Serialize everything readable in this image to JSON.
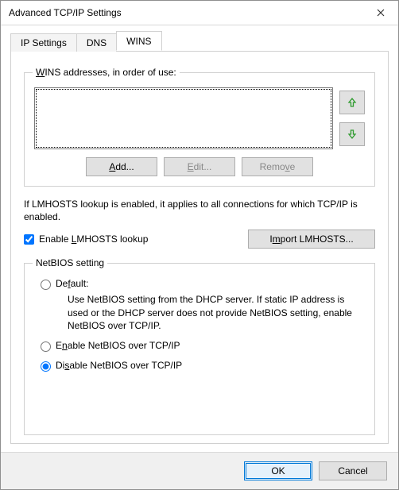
{
  "window": {
    "title": "Advanced TCP/IP Settings"
  },
  "tabs": {
    "ip_settings": "IP Settings",
    "dns": "DNS",
    "wins": "WINS",
    "active": "wins"
  },
  "wins": {
    "group_label": "WINS addresses, in order of use:",
    "group_label_html": "<span class='u'>W</span>INS addresses, in order of use:",
    "add": "Add...",
    "add_html": "<span class='u'>A</span>dd...",
    "edit": "Edit...",
    "edit_html": "<span class='u'>E</span>dit...",
    "remove": "Remove",
    "remove_html": "Remo<span class='u'>v</span>e"
  },
  "lmhosts": {
    "info": "If LMHOSTS lookup is enabled, it applies to all connections for which TCP/IP is enabled.",
    "checkbox_label": "Enable LMHOSTS lookup",
    "checkbox_html": "Enable <span class='u'>L</span>MHOSTS lookup",
    "checked": true,
    "import_btn": "Import LMHOSTS...",
    "import_html": "I<span class='u'>m</span>port LMHOSTS..."
  },
  "netbios": {
    "group_label": "NetBIOS setting",
    "default_label": "Default:",
    "default_html": "De<span class='u'>f</span>ault:",
    "default_desc": "Use NetBIOS setting from the DHCP server. If static IP address is used or the DHCP server does not provide NetBIOS setting, enable NetBIOS over TCP/IP.",
    "enable_label": "Enable NetBIOS over TCP/IP",
    "enable_html": "E<span class='u'>n</span>able NetBIOS over TCP/IP",
    "disable_label": "Disable NetBIOS over TCP/IP",
    "disable_html": "Di<span class='u'>s</span>able NetBIOS over TCP/IP",
    "selected": "disable"
  },
  "footer": {
    "ok": "OK",
    "cancel": "Cancel"
  },
  "colors": {
    "accent": "#0078d7",
    "arrow": "#2e9b2e"
  }
}
